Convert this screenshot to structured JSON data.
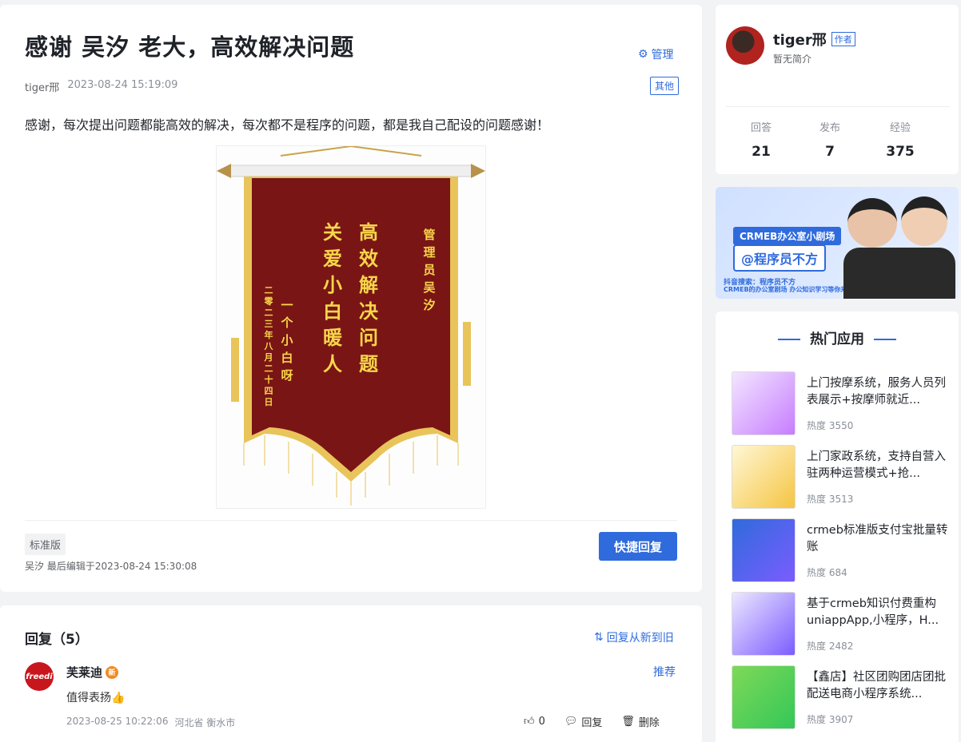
{
  "post": {
    "title": "感谢 吴汐 老大，高效解决问题",
    "manage_label": "管理",
    "author": "tiger邢",
    "time": "2023-08-24 15:19:09",
    "tag": "其他",
    "body": "感谢，每次提出问题都能高效的解决，每次都不是程序的问题，都是我自己配设的问题感谢！",
    "banner": {
      "main_col1": "高效解决问题",
      "main_col2": "关爱小白暖人",
      "right_col": "管理员 吴汐",
      "left_col1": "一个小白呀",
      "left_col2": "二零二三年八月二十四日"
    },
    "edition_tag": "标准版",
    "quick_reply_label": "快捷回复",
    "edited_note": "吴汐 最后编辑于2023-08-24 15:30:08"
  },
  "replies": {
    "heading": "回复（5）",
    "sort_label": "回复从新到旧",
    "items": [
      {
        "avatar_text": "freedi",
        "user": "芙莱迪",
        "badge": "新",
        "recommend_label": "推荐",
        "content": "值得表扬👍",
        "time": "2023-08-25 10:22:06",
        "location": "河北省 衡水市",
        "likes": "0",
        "reply_label": "回复",
        "delete_label": "删除"
      }
    ]
  },
  "author": {
    "name": "tiger邢",
    "tag": "作者",
    "bio": "暂无简介",
    "stats": [
      {
        "label": "回答",
        "value": "21"
      },
      {
        "label": "发布",
        "value": "7"
      },
      {
        "label": "经验",
        "value": "375"
      }
    ]
  },
  "ad_banner": {
    "title": "CRMEB办公室小剧场",
    "subtitle": "@程序员不方",
    "line1": "抖音搜索：程序员不方",
    "line2": "CRMEB的办公室剧场 办公知识学习等你来撩!"
  },
  "hot": {
    "title": "热门应用",
    "items": [
      {
        "name": "上门按摩系统，服务人员列表展示+按摩师就近...",
        "heat": "热度 3550",
        "thumb_color": "#c77dff"
      },
      {
        "name": "上门家政系统，支持自营入驻两种运营模式+抢...",
        "heat": "热度 3513",
        "thumb_color": "#f5c542"
      },
      {
        "name": "crmeb标准版支付宝批量转账",
        "heat": "热度 684",
        "thumb_color": "#2f6bdc"
      },
      {
        "name": "基于crmeb知识付费重构uniappApp,小程序，H...",
        "heat": "热度 2482",
        "thumb_color": "#7b5cff"
      },
      {
        "name": "【鑫店】社区团购团店团批配送电商小程序系统...",
        "heat": "热度 3907",
        "thumb_color": "#34c759"
      }
    ]
  }
}
